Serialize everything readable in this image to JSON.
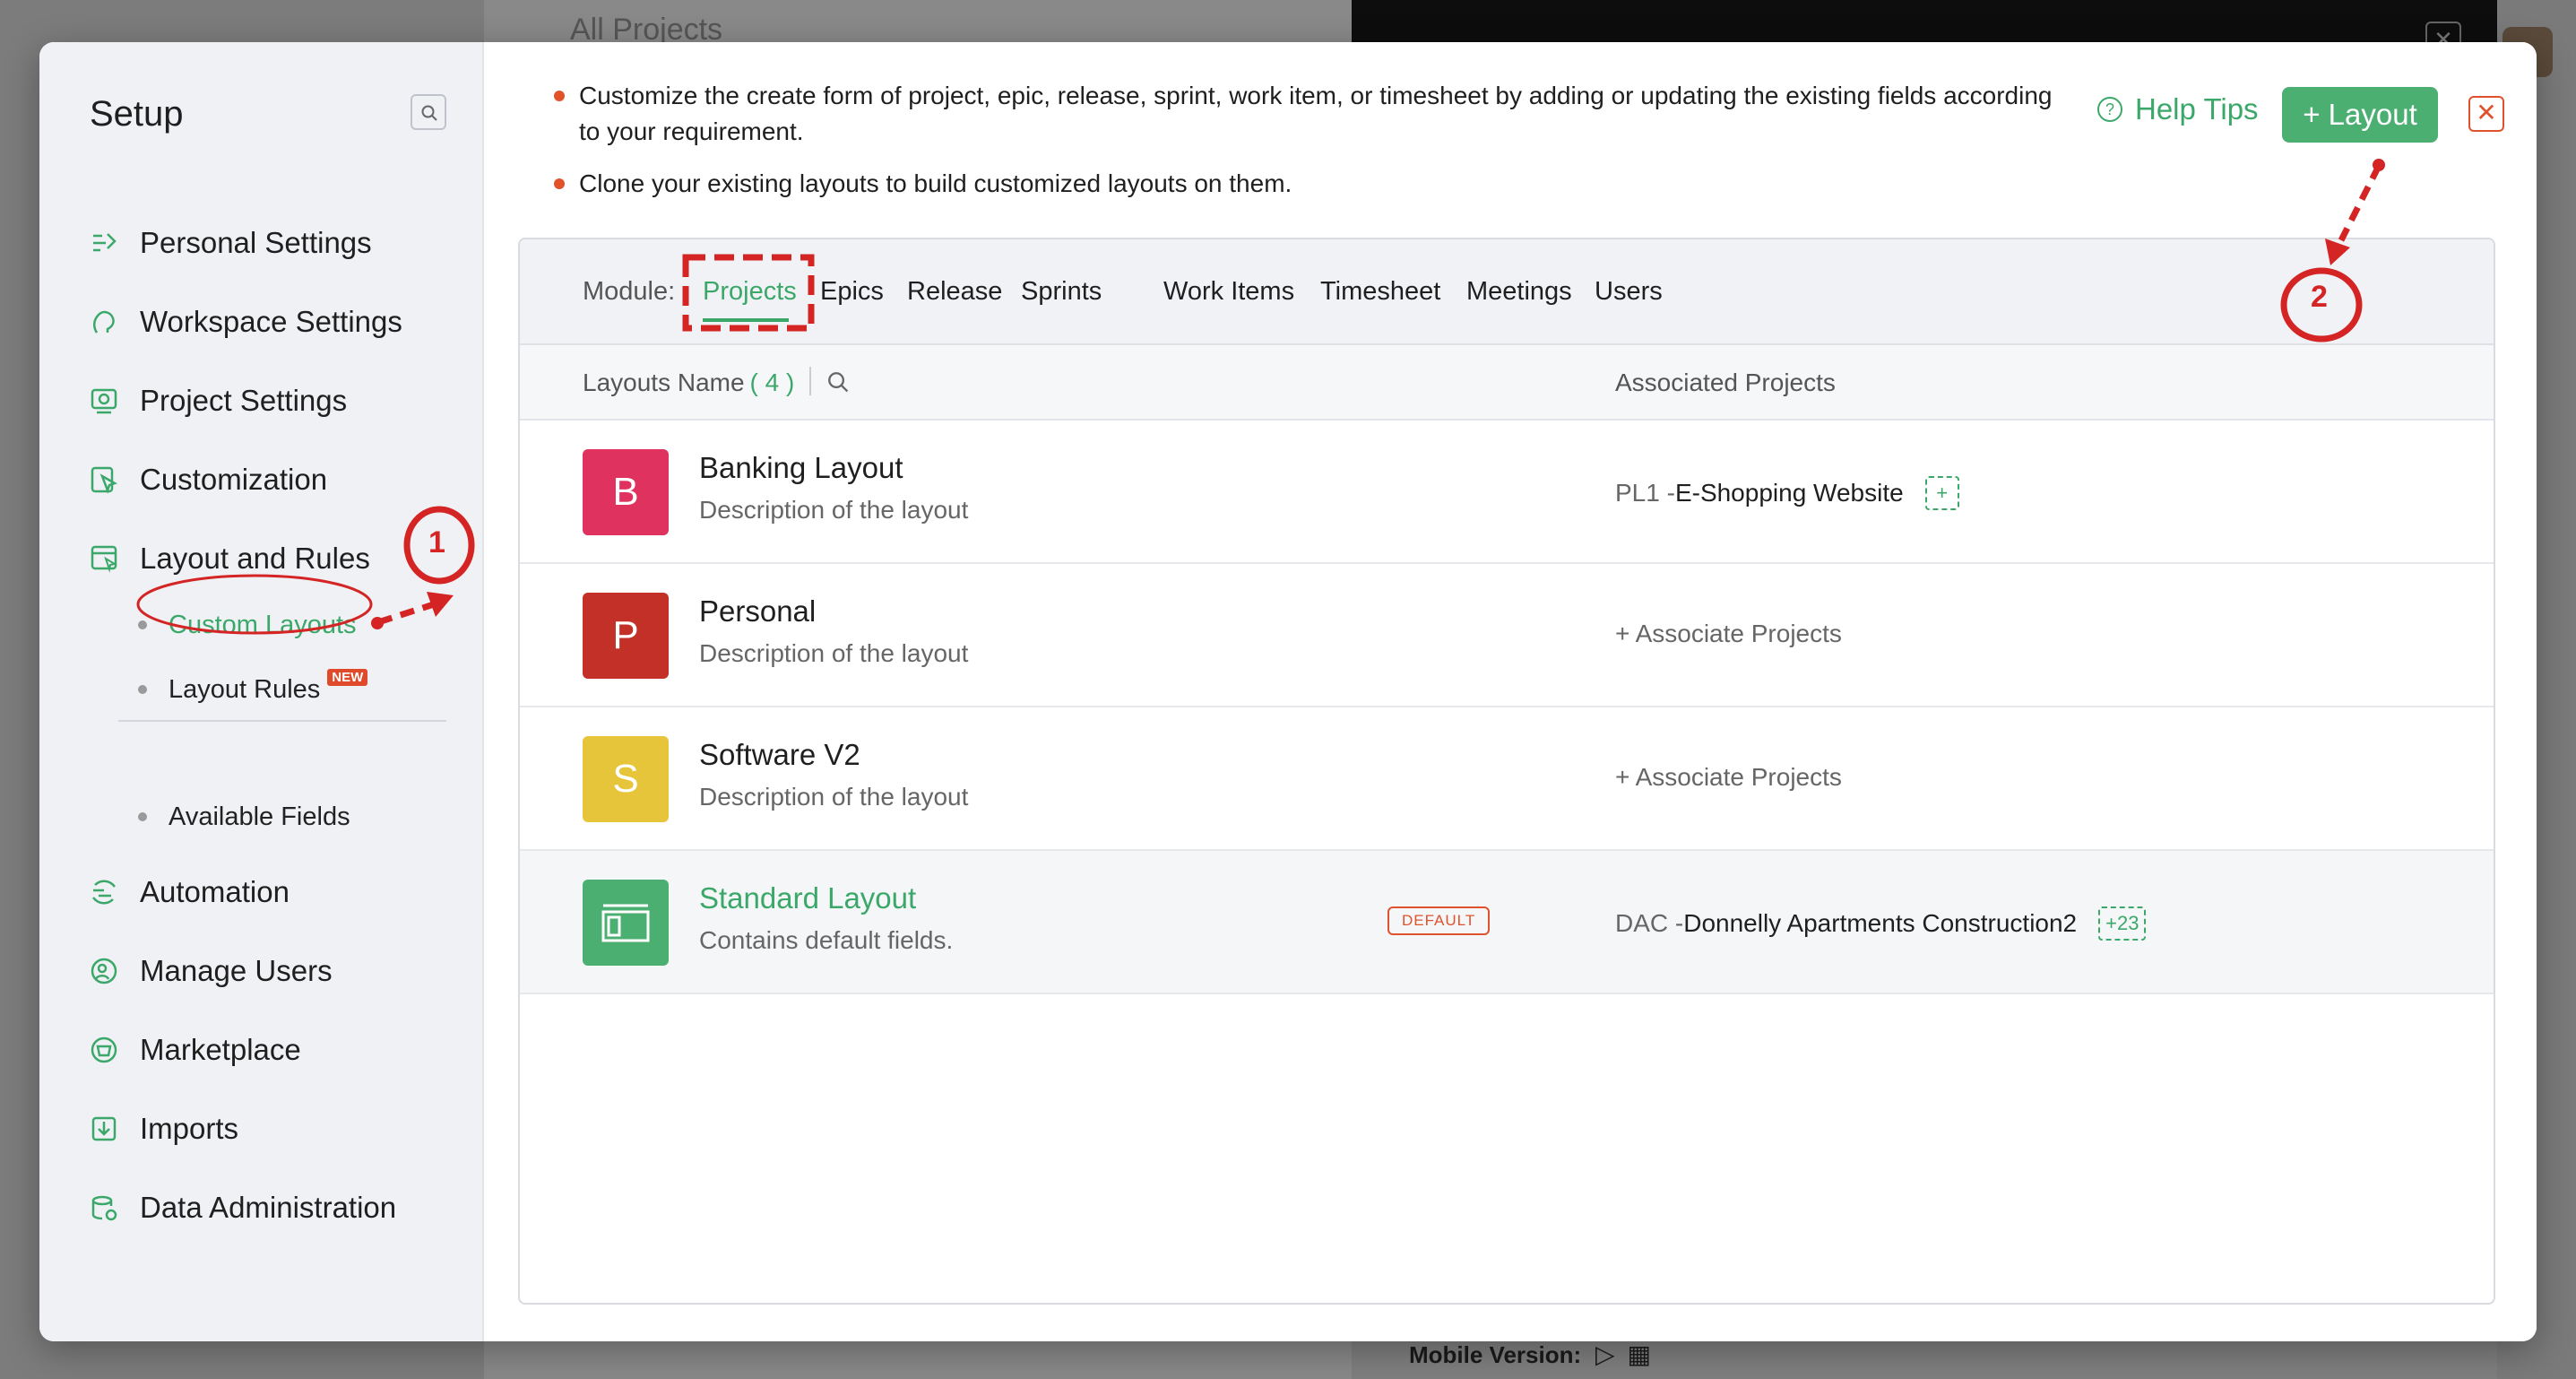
{
  "background": {
    "title": "All Projects",
    "mobile_label": "Mobile Version:",
    "mobile_icons": [
      "apple-icon",
      "play-icon",
      "qr-icon"
    ]
  },
  "sidebar": {
    "title": "Setup",
    "items": [
      {
        "label": "Personal Settings",
        "icon": "personal-settings-icon"
      },
      {
        "label": "Workspace Settings",
        "icon": "workspace-icon"
      },
      {
        "label": "Project Settings",
        "icon": "project-settings-icon"
      },
      {
        "label": "Customization",
        "icon": "customization-icon"
      },
      {
        "label": "Layout and Rules",
        "icon": "layout-rules-icon"
      },
      {
        "label": "Automation",
        "icon": "automation-icon"
      },
      {
        "label": "Manage Users",
        "icon": "users-icon"
      },
      {
        "label": "Marketplace",
        "icon": "marketplace-icon"
      },
      {
        "label": "Imports",
        "icon": "imports-icon"
      },
      {
        "label": "Data Administration",
        "icon": "data-admin-icon"
      }
    ],
    "sub_items": [
      {
        "label": "Custom Layouts",
        "active": true
      },
      {
        "label": "Layout Rules",
        "badge": "NEW"
      },
      {
        "label": "Available Fields"
      }
    ]
  },
  "tips": [
    "Customize the create form of project, epic, release, sprint, work item, or timesheet by adding or updating the existing fields according to your requirement.",
    "Clone your existing layouts to build customized layouts on them."
  ],
  "header": {
    "help_tips": "Help Tips",
    "add_layout": "+ Layout",
    "close": "✕"
  },
  "module": {
    "label": "Module:",
    "tabs": [
      "Projects",
      "Epics",
      "Release",
      "Sprints",
      "Work Items",
      "Timesheet",
      "Meetings",
      "Users"
    ],
    "active_tab": "Projects"
  },
  "table": {
    "col_name": "Layouts Name",
    "count": "( 4 )",
    "col_assoc": "Associated Projects",
    "rows": [
      {
        "letter": "B",
        "color": "#e0325f",
        "title": "Banking Layout",
        "desc": "Description of the layout",
        "assoc_code": "PL1 - ",
        "assoc_project": "E-Shopping Website",
        "assoc_more": "+"
      },
      {
        "letter": "P",
        "color": "#c23028",
        "title": "Personal",
        "desc": "Description of the layout",
        "assoc_link": "+ Associate Projects"
      },
      {
        "letter": "S",
        "color": "#e6c53a",
        "title": "Software V2",
        "desc": "Description of the layout",
        "assoc_link": "+ Associate Projects"
      },
      {
        "icon": "standard-layout-icon",
        "color": "#4caf72",
        "title": "Standard Layout",
        "desc": "Contains default fields.",
        "badge": "DEFAULT",
        "assoc_code": "DAC - ",
        "assoc_project": "Donnelly Apartments Construction2",
        "assoc_more": "+23"
      }
    ]
  },
  "annotations": {
    "step1": "1",
    "step2": "2",
    "color": "#d42424"
  }
}
